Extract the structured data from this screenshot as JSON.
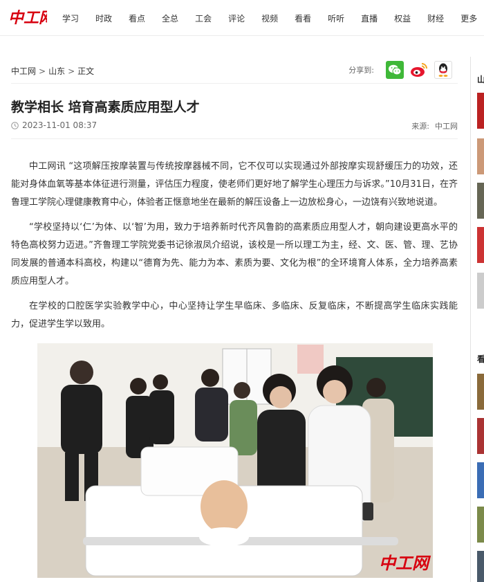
{
  "brand": {
    "logo_text": "中工网",
    "accent": "#d7000f"
  },
  "nav": [
    "学习",
    "时政",
    "看点",
    "全总",
    "工会",
    "评论",
    "视频",
    "看看",
    "听听",
    "直播",
    "权益",
    "财经",
    "更多"
  ],
  "breadcrumb": {
    "home": "中工网",
    "section": "山东",
    "current": "正文",
    "sep": ">"
  },
  "share": {
    "label": "分享到:",
    "icons": [
      "wechat-icon",
      "weibo-icon",
      "qq-icon"
    ]
  },
  "article": {
    "title": "教学相长 培育高素质应用型人才",
    "date": "2023-11-01 08:37",
    "source_label": "来源:",
    "source": "中工网",
    "paragraphs": [
      "中工网讯 “这项解压按摩装置与传统按摩器械不同，它不仅可以实现通过外部按摩实现舒缓压力的功效，还能对身体血氧等基本体征进行测量，评估压力程度，使老师们更好地了解学生心理压力与诉求。”10月31日，在齐鲁理工学院心理健康教育中心，体验者正惬意地坐在最新的解压设备上一边放松身心，一边饶有兴致地说道。",
      "“学校坚持以‘仁’为体、以‘智’为用，致力于培养新时代齐风鲁韵的高素质应用型人才，朝向建设更高水平的特色高校努力迈进。”齐鲁理工学院党委书记徐淑凤介绍说，该校是一所以理工为主，经、文、医、管、理、艺协同发展的普通本科高校，构建以“德育为先、能力为本、素质为要、文化为根”的全环境育人体系，全力培养高素质应用型人才。",
      "在学校的口腔医学实验教学中心，中心坚持让学生早临床、多临床、反复临床，不断提高学生临床实践能力，促进学生学以致用。"
    ],
    "photo_watermark": "中工网"
  },
  "sidebar": {
    "heading1": "山",
    "heading2": "看"
  }
}
